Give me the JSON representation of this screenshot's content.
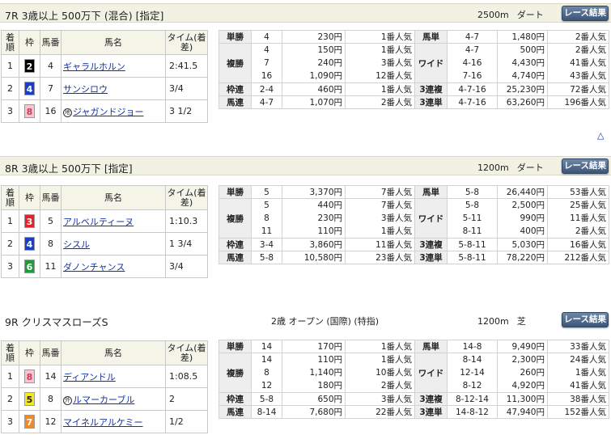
{
  "races": [
    {
      "title": "7R 3歳以上 500万下 (混合) [指定]",
      "class": "",
      "distance": "2500m",
      "surface": "ダート",
      "button_label": "レース結果",
      "headers": {
        "rank": "着順",
        "waku": "枠",
        "num": "馬番",
        "name": "馬名",
        "time": "タイム(着差)"
      },
      "finishers": [
        {
          "rank": "1",
          "waku": "2",
          "waku_bg": "#000000",
          "waku_fg": "#ffffff",
          "num": "4",
          "name": "ギャラルホルン",
          "marker": "",
          "time": "2:41.5"
        },
        {
          "rank": "2",
          "waku": "4",
          "waku_bg": "#1a3ecc",
          "waku_fg": "#ffffff",
          "num": "7",
          "name": "サンシロウ",
          "marker": "",
          "time": "3/4"
        },
        {
          "rank": "3",
          "waku": "8",
          "waku_bg": "#f7c6d1",
          "waku_fg": "#d03a5a",
          "num": "16",
          "name": "ジャガンドジョー",
          "marker": "地",
          "time": "3 1/2"
        }
      ],
      "payouts": {
        "tansho": {
          "label": "単勝",
          "combo": "4",
          "amount": "230円",
          "pop": "1番人気"
        },
        "fukusho": {
          "label": "複勝",
          "combos": [
            "4",
            "7",
            "16"
          ],
          "amounts": [
            "150円",
            "240円",
            "1,090円"
          ],
          "pops": [
            "1番人気",
            "3番人気",
            "12番人気"
          ]
        },
        "wakuren": {
          "label": "枠連",
          "combo": "2-4",
          "amount": "460円",
          "pop": "1番人気"
        },
        "umaren": {
          "label": "馬連",
          "combo": "4-7",
          "amount": "1,070円",
          "pop": "2番人気"
        },
        "umatan": {
          "label": "馬単",
          "combo": "4-7",
          "amount": "1,480円",
          "pop": "2番人気"
        },
        "wide": {
          "label": "ワイド",
          "combos": [
            "4-7",
            "4-16",
            "7-16"
          ],
          "amounts": [
            "500円",
            "4,430円",
            "4,740円"
          ],
          "pops": [
            "2番人気",
            "41番人気",
            "43番人気"
          ]
        },
        "sanrenpuku": {
          "label": "3連複",
          "combo": "4-7-16",
          "amount": "25,230円",
          "pop": "72番人気"
        },
        "sanrentan": {
          "label": "3連単",
          "combo": "4-7-16",
          "amount": "63,260円",
          "pop": "196番人気"
        }
      }
    },
    {
      "title": "8R 3歳以上 500万下 [指定]",
      "class": "",
      "distance": "1200m",
      "surface": "ダート",
      "button_label": "レース結果",
      "headers": {
        "rank": "着順",
        "waku": "枠",
        "num": "馬番",
        "name": "馬名",
        "time": "タイム(着差)"
      },
      "finishers": [
        {
          "rank": "1",
          "waku": "3",
          "waku_bg": "#e8202a",
          "waku_fg": "#ffffff",
          "num": "5",
          "name": "アルベルティーヌ",
          "marker": "",
          "time": "1:10.3"
        },
        {
          "rank": "2",
          "waku": "4",
          "waku_bg": "#1a3ecc",
          "waku_fg": "#ffffff",
          "num": "8",
          "name": "シスル",
          "marker": "",
          "time": "1 3/4"
        },
        {
          "rank": "3",
          "waku": "6",
          "waku_bg": "#1e9a3a",
          "waku_fg": "#ffffff",
          "num": "11",
          "name": "ダノンチャンス",
          "marker": "",
          "time": "3/4"
        }
      ],
      "payouts": {
        "tansho": {
          "label": "単勝",
          "combo": "5",
          "amount": "3,370円",
          "pop": "7番人気"
        },
        "fukusho": {
          "label": "複勝",
          "combos": [
            "5",
            "8",
            "11"
          ],
          "amounts": [
            "440円",
            "230円",
            "110円"
          ],
          "pops": [
            "7番人気",
            "3番人気",
            "1番人気"
          ]
        },
        "wakuren": {
          "label": "枠連",
          "combo": "3-4",
          "amount": "3,860円",
          "pop": "11番人気"
        },
        "umaren": {
          "label": "馬連",
          "combo": "5-8",
          "amount": "10,580円",
          "pop": "23番人気"
        },
        "umatan": {
          "label": "馬単",
          "combo": "5-8",
          "amount": "26,440円",
          "pop": "53番人気"
        },
        "wide": {
          "label": "ワイド",
          "combos": [
            "5-8",
            "5-11",
            "8-11"
          ],
          "amounts": [
            "2,500円",
            "990円",
            "400円"
          ],
          "pops": [
            "25番人気",
            "11番人気",
            "2番人気"
          ]
        },
        "sanrenpuku": {
          "label": "3連複",
          "combo": "5-8-11",
          "amount": "5,030円",
          "pop": "16番人気"
        },
        "sanrentan": {
          "label": "3連単",
          "combo": "5-8-11",
          "amount": "78,220円",
          "pop": "212番人気"
        }
      }
    },
    {
      "title": "9R クリスマスローズS",
      "class": "2歳 オープン (国際) (特指)",
      "distance": "1200m",
      "surface": "芝",
      "button_label": "レース結果",
      "headers": {
        "rank": "着順",
        "waku": "枠",
        "num": "馬番",
        "name": "馬名",
        "time": "タイム(着差)"
      },
      "finishers": [
        {
          "rank": "1",
          "waku": "8",
          "waku_bg": "#f7c6d1",
          "waku_fg": "#d03a5a",
          "num": "14",
          "name": "ディアンドル",
          "marker": "",
          "time": "1:08.5"
        },
        {
          "rank": "2",
          "waku": "5",
          "waku_bg": "#f7e81a",
          "waku_fg": "#222222",
          "num": "8",
          "name": "ルマーカーブル",
          "marker": "外",
          "time": "2"
        },
        {
          "rank": "3",
          "waku": "7",
          "waku_bg": "#f08a28",
          "waku_fg": "#ffffff",
          "num": "12",
          "name": "マイネルアルケミー",
          "marker": "",
          "time": "1/2"
        }
      ],
      "payouts": {
        "tansho": {
          "label": "単勝",
          "combo": "14",
          "amount": "170円",
          "pop": "1番人気"
        },
        "fukusho": {
          "label": "複勝",
          "combos": [
            "14",
            "8",
            "12"
          ],
          "amounts": [
            "110円",
            "1,140円",
            "180円"
          ],
          "pops": [
            "1番人気",
            "10番人気",
            "2番人気"
          ]
        },
        "wakuren": {
          "label": "枠連",
          "combo": "5-8",
          "amount": "650円",
          "pop": "3番人気"
        },
        "umaren": {
          "label": "馬連",
          "combo": "8-14",
          "amount": "7,680円",
          "pop": "22番人気"
        },
        "umatan": {
          "label": "馬単",
          "combo": "14-8",
          "amount": "9,490円",
          "pop": "33番人気"
        },
        "wide": {
          "label": "ワイド",
          "combos": [
            "8-14",
            "12-14",
            "8-12"
          ],
          "amounts": [
            "2,300円",
            "260円",
            "4,920円"
          ],
          "pops": [
            "24番人気",
            "1番人気",
            "41番人気"
          ]
        },
        "sanrenpuku": {
          "label": "3連複",
          "combo": "8-12-14",
          "amount": "11,300円",
          "pop": "38番人気"
        },
        "sanrentan": {
          "label": "3連単",
          "combo": "14-8-12",
          "amount": "47,940円",
          "pop": "152番人気"
        }
      }
    }
  ],
  "top_link_icon": "up-triangle-icon",
  "top_link_glyph": "△"
}
